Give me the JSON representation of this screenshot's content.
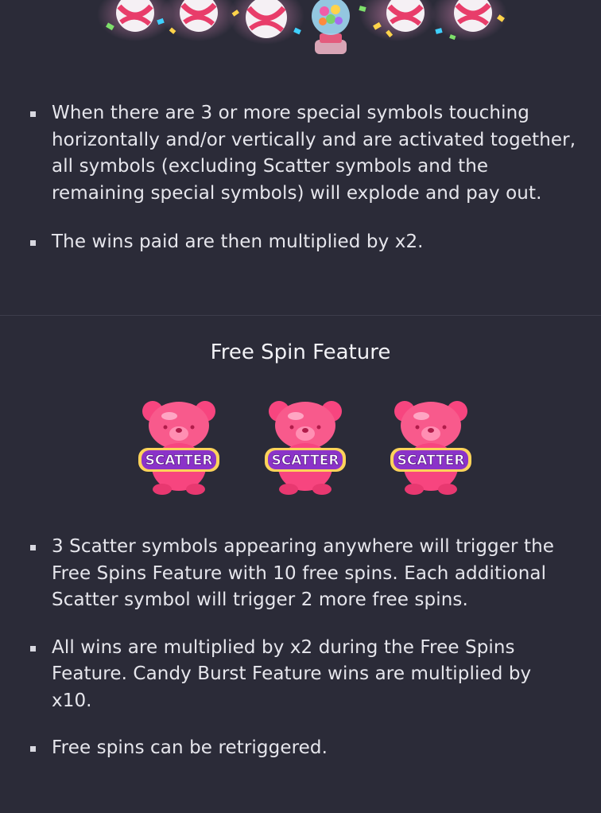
{
  "icons": {
    "top_banner": "candy-burst-art",
    "scatter_symbol": "gummy-bear-scatter-icon"
  },
  "colors": {
    "background": "#2b2b38",
    "text": "#e6e6ec",
    "bear_pink": "#f7457f",
    "scatter_label": "#8b33c9"
  },
  "candy_burst": {
    "bullets": [
      "When there are 3 or more special symbols touching horizontally and/or vertically and are activated together, all symbols (excluding Scatter symbols and the remaining special symbols) will explode and pay out.",
      "The wins paid are then multiplied by x2."
    ]
  },
  "free_spin": {
    "title": "Free Spin Feature",
    "scatter_label": "SCATTER",
    "bullets": [
      "3 Scatter symbols appearing anywhere will trigger the Free Spins Feature with 10 free spins. Each additional Scatter symbol will trigger 2 more free spins.",
      "All wins are multiplied by x2 during the Free Spins Feature. Candy Burst Feature wins are multiplied by x10.",
      "Free spins can be retriggered."
    ]
  }
}
